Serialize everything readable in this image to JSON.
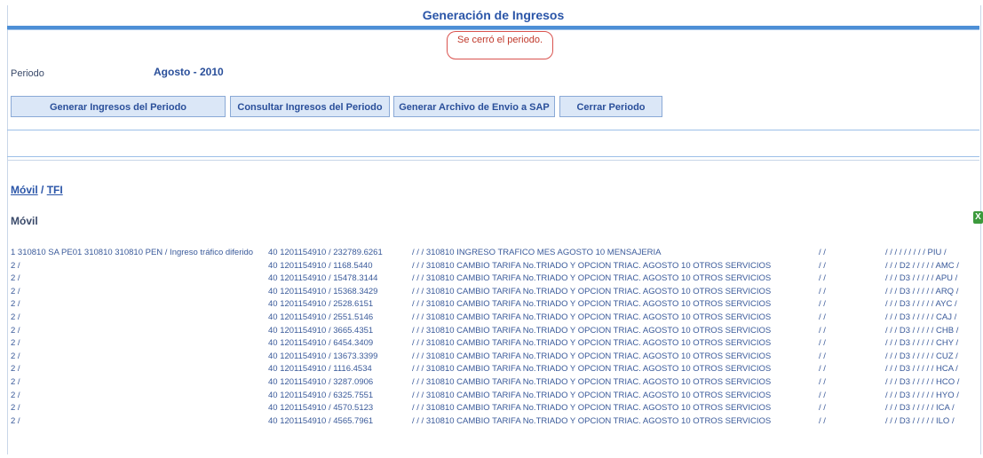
{
  "header": {
    "title": "Generación de Ingresos"
  },
  "message": "Se cerró el periodo.",
  "period": {
    "label": "Periodo",
    "value": "Agosto - 2010"
  },
  "buttons": {
    "generate": "Generar Ingresos del Periodo",
    "consult": "Consultar Ingresos del Periodo",
    "sap": "Generar Archivo de Envio a SAP",
    "close": "Cerrar Periodo"
  },
  "tabs": {
    "movil": "Móvil",
    "divider": " / ",
    "tfi": "TFI"
  },
  "section_title": "Móvil",
  "export_icon": "X",
  "rows": [
    {
      "c1": "1 310810 SA PE01 310810 310810 PEN / Ingreso tráfico diferido",
      "acct": "40 1201154910",
      "amt": "/ 232789.6261",
      "desc": "/ / / 310810 INGRESO TRAFICO MES AGOSTO 10 MENSAJERIA",
      "mid": "/ /",
      "code": "/ / / /   / / / / / PIU /"
    },
    {
      "c1": "2 /",
      "acct": "40 1201154910",
      "amt": "/ 1168.5440",
      "desc": "/ / / 310810 CAMBIO TARIFA No.TRIADO Y OPCION TRIAC. AGOSTO 10 OTROS SERVICIOS",
      "mid": "/ /",
      "code": "/ / / D2 / / / / / AMC /"
    },
    {
      "c1": "2 /",
      "acct": "40 1201154910",
      "amt": "/ 15478.3144",
      "desc": "/ / / 310810 CAMBIO TARIFA No.TRIADO Y OPCION TRIAC. AGOSTO 10 OTROS SERVICIOS",
      "mid": "/ /",
      "code": "/ / / D3 / / / / / APU /"
    },
    {
      "c1": "2 /",
      "acct": "40 1201154910",
      "amt": "/ 15368.3429",
      "desc": "/ / / 310810 CAMBIO TARIFA No.TRIADO Y OPCION TRIAC. AGOSTO 10 OTROS SERVICIOS",
      "mid": "/ /",
      "code": "/ / / D3 / / / / / ARQ /"
    },
    {
      "c1": "2 /",
      "acct": "40 1201154910",
      "amt": "/ 2528.6151",
      "desc": "/ / / 310810 CAMBIO TARIFA No.TRIADO Y OPCION TRIAC. AGOSTO 10 OTROS SERVICIOS",
      "mid": "/ /",
      "code": "/ / / D3 / / / / / AYC /"
    },
    {
      "c1": "2 /",
      "acct": "40 1201154910",
      "amt": "/ 2551.5146",
      "desc": "/ / / 310810 CAMBIO TARIFA No.TRIADO Y OPCION TRIAC. AGOSTO 10 OTROS SERVICIOS",
      "mid": "/ /",
      "code": "/ / / D3 / / / / / CAJ /"
    },
    {
      "c1": "2 /",
      "acct": "40 1201154910",
      "amt": "/ 3665.4351",
      "desc": "/ / / 310810 CAMBIO TARIFA No.TRIADO Y OPCION TRIAC. AGOSTO 10 OTROS SERVICIOS",
      "mid": "/ /",
      "code": "/ / / D3 / / / / / CHB /"
    },
    {
      "c1": "2 /",
      "acct": "40 1201154910",
      "amt": "/ 6454.3409",
      "desc": "/ / / 310810 CAMBIO TARIFA No.TRIADO Y OPCION TRIAC. AGOSTO 10 OTROS SERVICIOS",
      "mid": "/ /",
      "code": "/ / / D3 / / / / / CHY /"
    },
    {
      "c1": "2 /",
      "acct": "40 1201154910",
      "amt": "/ 13673.3399",
      "desc": "/ / / 310810 CAMBIO TARIFA No.TRIADO Y OPCION TRIAC. AGOSTO 10 OTROS SERVICIOS",
      "mid": "/ /",
      "code": "/ / / D3 / / / / / CUZ /"
    },
    {
      "c1": "2 /",
      "acct": "40 1201154910",
      "amt": "/ 1116.4534",
      "desc": "/ / / 310810 CAMBIO TARIFA No.TRIADO Y OPCION TRIAC. AGOSTO 10 OTROS SERVICIOS",
      "mid": "/ /",
      "code": "/ / / D3 / / / / / HCA /"
    },
    {
      "c1": "2 /",
      "acct": "40 1201154910",
      "amt": "/ 3287.0906",
      "desc": "/ / / 310810 CAMBIO TARIFA No.TRIADO Y OPCION TRIAC. AGOSTO 10 OTROS SERVICIOS",
      "mid": "/ /",
      "code": "/ / / D3 / / / / / HCO /"
    },
    {
      "c1": "2 /",
      "acct": "40 1201154910",
      "amt": "/ 6325.7551",
      "desc": "/ / / 310810 CAMBIO TARIFA No.TRIADO Y OPCION TRIAC. AGOSTO 10 OTROS SERVICIOS",
      "mid": "/ /",
      "code": "/ / / D3 / / / / / HYO /"
    },
    {
      "c1": "2 /",
      "acct": "40 1201154910",
      "amt": "/ 4570.5123",
      "desc": "/ / / 310810 CAMBIO TARIFA No.TRIADO Y OPCION TRIAC. AGOSTO 10 OTROS SERVICIOS",
      "mid": "/ /",
      "code": "/ / / D3 / / / / / ICA /"
    },
    {
      "c1": "2 /",
      "acct": "40 1201154910",
      "amt": "/ 4565.7961",
      "desc": "/ / / 310810 CAMBIO TARIFA No.TRIADO Y OPCION TRIAC. AGOSTO 10 OTROS SERVICIOS",
      "mid": "/ /",
      "code": "/ / / D3 / / / / / ILO /"
    }
  ]
}
